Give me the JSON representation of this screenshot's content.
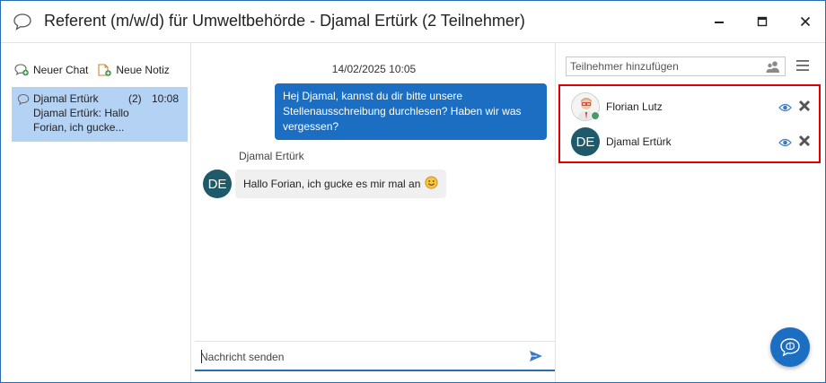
{
  "window": {
    "title": "Referent (m/w/d) für Umweltbehörde - Djamal Ertürk (2 Teilnehmer)",
    "icons": {
      "app": "chat-bubble-icon",
      "minimize": "minimize-icon",
      "maximize": "maximize-icon",
      "close": "close-icon"
    }
  },
  "left": {
    "new_chat_label": "Neuer Chat",
    "new_note_label": "Neue Notiz",
    "chats": [
      {
        "name": "Djamal Ertürk",
        "count": "(2)",
        "time": "10:08",
        "preview": "Djamal Ertürk: Hallo Forian, ich gucke..."
      }
    ]
  },
  "conversation": {
    "date": "14/02/2025 10:05",
    "messages": [
      {
        "direction": "outgoing",
        "text": "Hej Djamal, kannst du dir bitte unsere Stellenausschreibung durchlesen? Haben wir was vergessen?"
      },
      {
        "direction": "incoming",
        "sender": "Djamal Ertürk",
        "avatar_initials": "DE",
        "text": "Hallo Forian, ich gucke es mir mal an",
        "emoji": "smiley-icon"
      }
    ],
    "compose_placeholder": "Nachricht senden"
  },
  "participants_panel": {
    "add_placeholder": "Teilnehmer hinzufügen",
    "participants": [
      {
        "name": "Florian Lutz",
        "avatar": "photo",
        "online": true
      },
      {
        "name": "Djamal Ertürk",
        "avatar_initials": "DE"
      }
    ]
  },
  "colors": {
    "accent": "#1b6ec2",
    "selected_chat": "#b4d3f4",
    "avatar_de": "#1e5a6a",
    "highlight_border": "#e00000",
    "online": "#4c9a6b"
  }
}
